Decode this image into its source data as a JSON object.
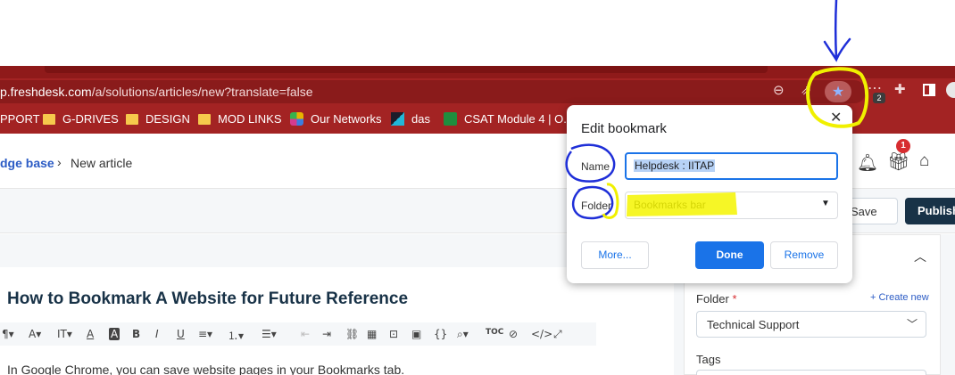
{
  "browser": {
    "url_host": "p.freshdesk.com",
    "url_path": "/a/solutions/articles/new?translate=false",
    "extensions_badge": "2",
    "bookmarks": [
      {
        "label": "PPORT",
        "icon": "none"
      },
      {
        "label": "G-DRIVES",
        "icon": "folder-icon"
      },
      {
        "label": "DESIGN",
        "icon": "folder-icon"
      },
      {
        "label": "MOD LINKS",
        "icon": "folder-icon"
      },
      {
        "label": "Our Networks",
        "icon": "networks-icon"
      },
      {
        "label": "das",
        "icon": "das-icon"
      },
      {
        "label": "CSAT Module 4 | O...",
        "icon": "sheets-icon"
      }
    ]
  },
  "page": {
    "breadcrumb": {
      "parent": "dge base",
      "separator": "›",
      "current": "New article"
    },
    "notification_badge": "1",
    "actions": {
      "save": "Save",
      "publish": "Publish"
    },
    "article_title": "How to Bookmark A Website for Future Reference",
    "body_text": "In Google Chrome, you can save website pages in your Bookmarks tab.",
    "sidebar": {
      "folder_label": "Folder",
      "required_mark": "*",
      "create_new": "+ Create new",
      "folder_value": "Technical Support",
      "tags_label": "Tags"
    }
  },
  "dialog": {
    "title": "Edit bookmark",
    "name_label": "Name",
    "name_value": "Helpdesk : IITAP",
    "folder_label": "Folder",
    "folder_value": "Bookmarks bar",
    "more": "More...",
    "done": "Done",
    "remove": "Remove"
  },
  "colors": {
    "chrome_red": "#a32323",
    "accent_blue": "#1a73e8",
    "annotation_blue": "#1f2fd8",
    "highlight_yellow": "#f5f500"
  }
}
